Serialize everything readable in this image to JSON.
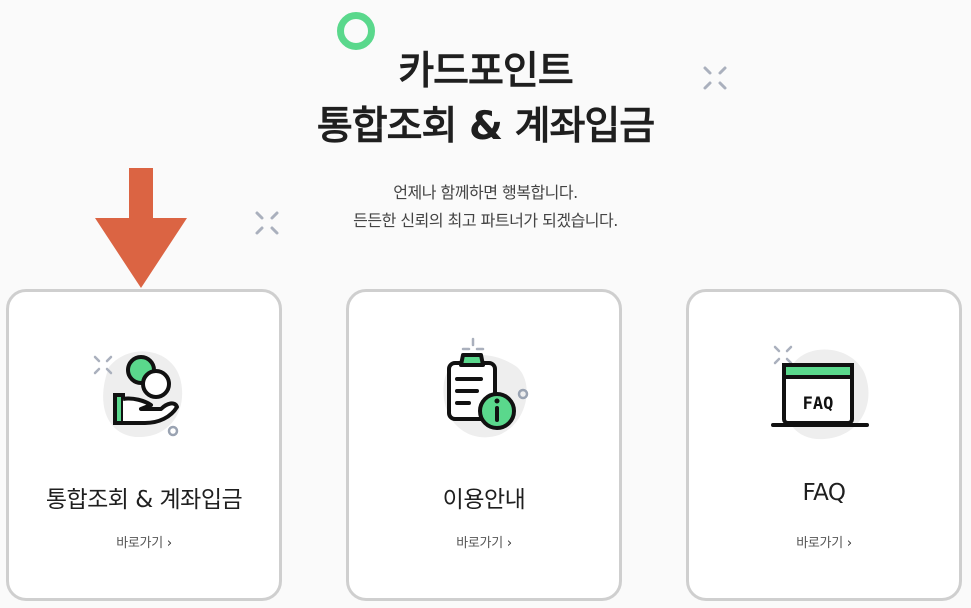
{
  "hero": {
    "title_line1": "카드포인트",
    "title_line2": "통합조회 & 계좌입금",
    "subtitle_line1": "언제나 함께하면 행복합니다.",
    "subtitle_line2": "든든한 신뢰의 최고 파트너가 되겠습니다."
  },
  "cards": [
    {
      "title": "통합조회 & 계좌입금",
      "link": "바로가기",
      "icon": "coin-hand-icon"
    },
    {
      "title": "이용안내",
      "link": "바로가기",
      "icon": "clipboard-info-icon"
    },
    {
      "title": "FAQ",
      "link": "바로가기",
      "icon": "faq-window-icon",
      "icon_text": "FAQ"
    }
  ],
  "colors": {
    "accent_green": "#5ad88c",
    "arrow": "#db6443",
    "card_border": "#cfcfcf",
    "icon_blob": "#eeeeee"
  }
}
